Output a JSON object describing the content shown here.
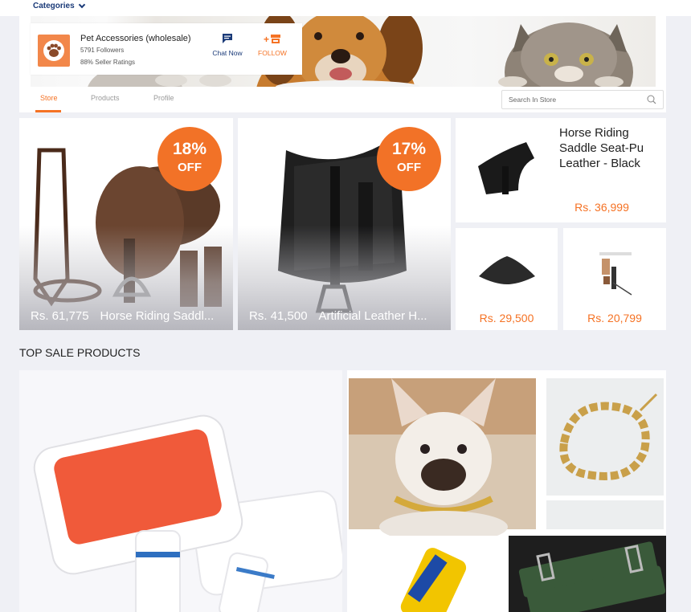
{
  "topbar": {
    "categories_label": "Categories"
  },
  "store": {
    "name": "Pet Accessories (wholesale)",
    "followers": "5791 Followers",
    "ratings": "88% Seller Ratings",
    "chat_label": "Chat Now",
    "follow_label": "FOLLOW",
    "follow_icon_text": "+"
  },
  "tabs": [
    {
      "label": "Store"
    },
    {
      "label": "Products"
    },
    {
      "label": "Profile"
    }
  ],
  "search": {
    "placeholder": "Search In Store"
  },
  "products": [
    {
      "price": "Rs. 61,775",
      "name": "Horse Riding Saddl...",
      "discount": "18%",
      "off": "OFF"
    },
    {
      "price": "Rs. 41,500",
      "name": "Artificial Leather H...",
      "discount": "17%",
      "off": "OFF"
    },
    {
      "title": "Horse Riding Saddle Seat-Pu Leather - Black",
      "price": "Rs. 36,999"
    },
    {
      "price": "Rs. 29,500"
    },
    {
      "price": "Rs. 20,799"
    }
  ],
  "top_sale": {
    "title": "TOP SALE PRODUCTS"
  },
  "colors": {
    "accent": "#f57224",
    "brand_blue": "#1a3a78",
    "badge": "#f27227"
  }
}
